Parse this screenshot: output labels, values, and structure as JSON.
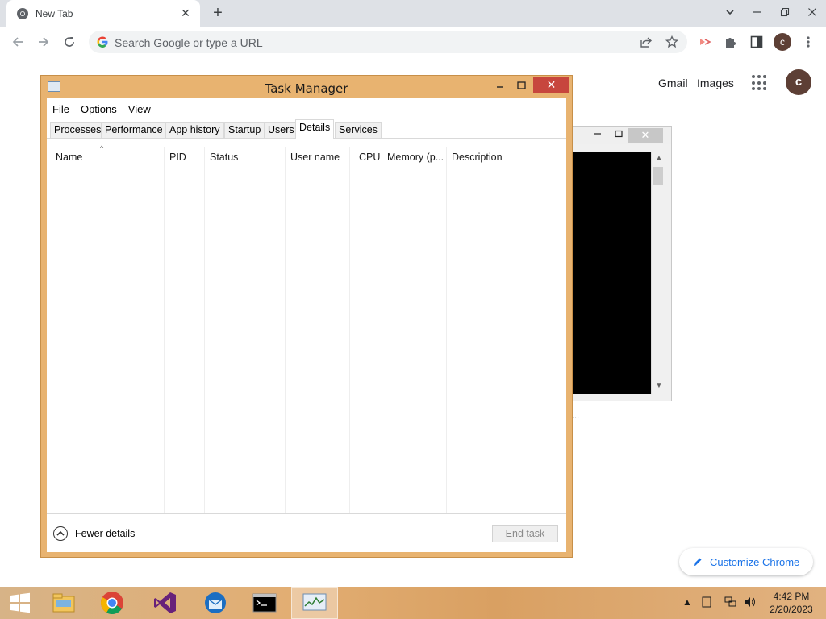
{
  "browser": {
    "tab_title": "New Tab",
    "new_tab_symbol": "+",
    "close_symbol": "✕",
    "omnibox_placeholder": "Search Google or type a URL",
    "profile_initial": "c"
  },
  "ntp": {
    "gmail_label": "Gmail",
    "images_label": "Images",
    "profile_initial": "c",
    "customize_label": "Customize Chrome"
  },
  "console_caption": "...",
  "task_manager": {
    "title": "Task Manager",
    "menu": [
      "File",
      "Options",
      "View"
    ],
    "tabs": [
      "Processes",
      "Performance",
      "App history",
      "Startup",
      "Users",
      "Details",
      "Services"
    ],
    "active_tab": "Details",
    "columns": [
      "Name",
      "PID",
      "Status",
      "User name",
      "CPU",
      "Memory (p...",
      "Description"
    ],
    "fewer_details_label": "Fewer details",
    "end_task_label": "End task"
  },
  "taskbar": {
    "time": "4:42 PM",
    "date": "2/20/2023"
  },
  "colors": {
    "tm_frame": "#e8b370",
    "tm_close": "#c7463d",
    "chrome_tabstrip": "#dee1e6",
    "profile": "#5d3f35",
    "accent": "#1a73e8"
  }
}
